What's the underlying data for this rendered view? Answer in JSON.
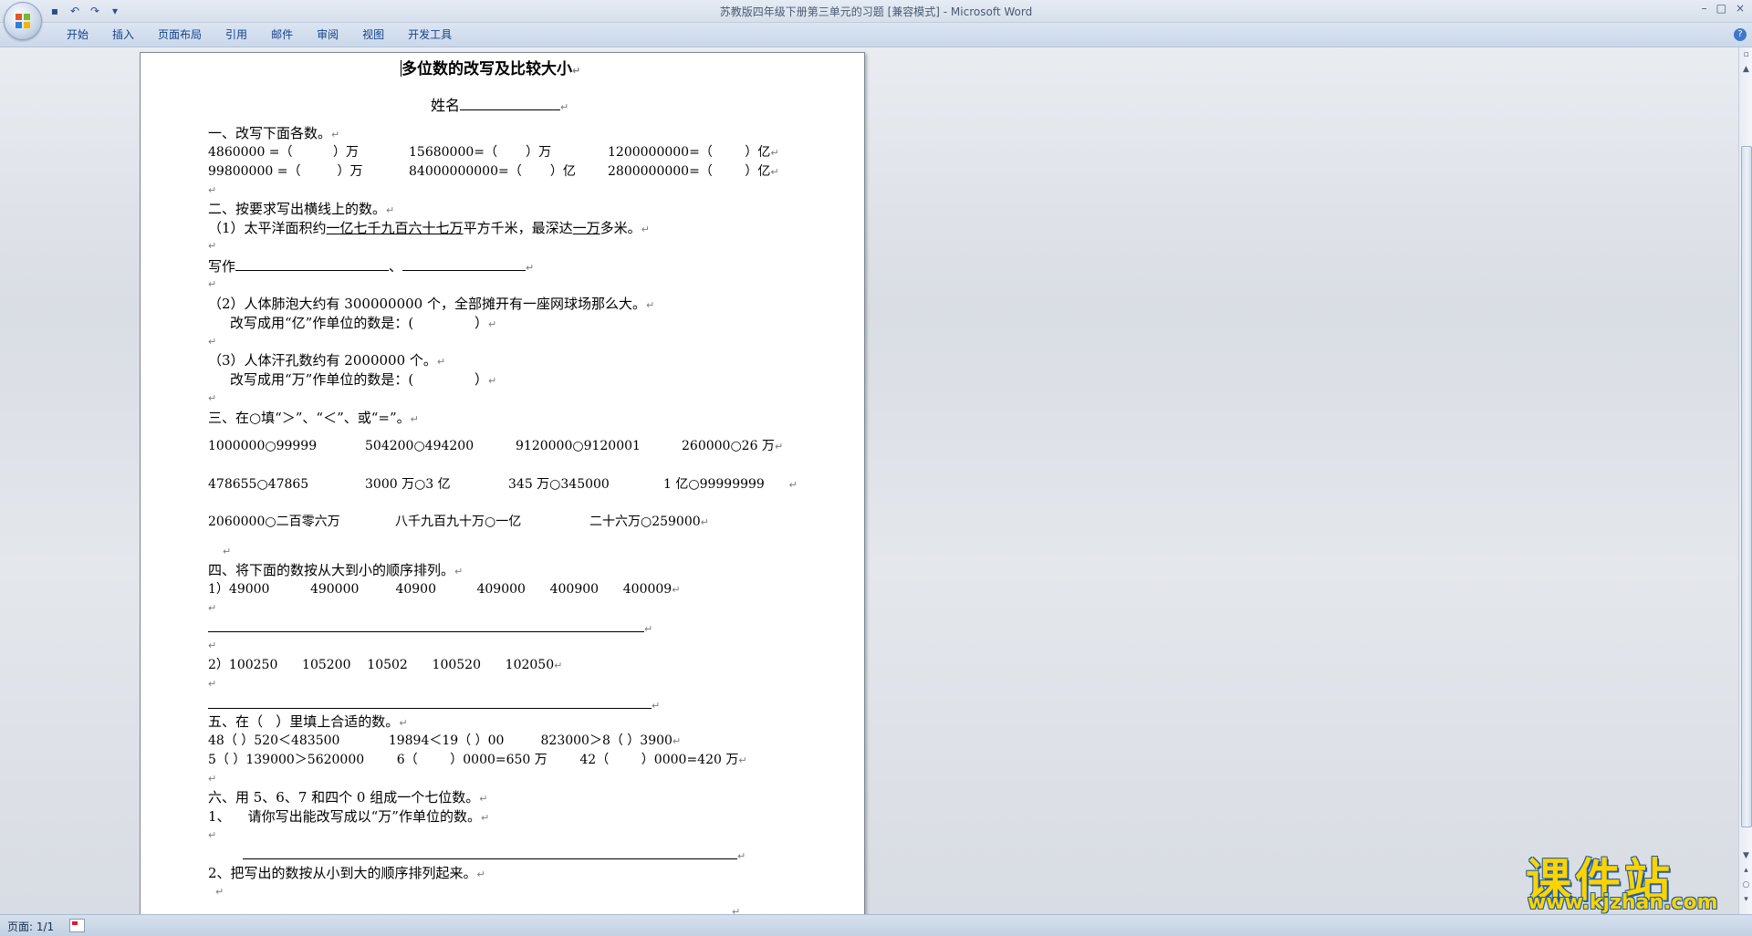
{
  "window": {
    "title": "苏教版四年级下册第三单元的习题 [兼容模式] - Microsoft Word",
    "controls": [
      "–",
      "□",
      "×"
    ]
  },
  "quick_access": {
    "items": [
      {
        "name": "save-icon",
        "glyph": "▪"
      },
      {
        "name": "undo-icon",
        "glyph": "↶"
      },
      {
        "name": "redo-icon",
        "glyph": "↷"
      },
      {
        "name": "customize-icon",
        "glyph": "▾"
      }
    ]
  },
  "ribbon": {
    "tabs": [
      "开始",
      "插入",
      "页面布局",
      "引用",
      "邮件",
      "审阅",
      "视图",
      "开发工具"
    ],
    "help": "?"
  },
  "document": {
    "title": "多位数的改写及比较大小",
    "name_label": "姓名",
    "s1_heading": "一、改写下面各数。",
    "s1_r1": [
      "4860000 =（          ）万",
      "15680000=（       ）万",
      "1200000000=（        ）亿"
    ],
    "s1_r2": [
      "99800000 =（         ）万",
      "84000000000=（       ）亿",
      "2800000000=（        ）亿"
    ],
    "s2_heading": "二、按要求写出横线上的数。",
    "s2_q1_pre": "（1）太平洋面积约",
    "s2_q1_u1": "一亿七千九百六十七万",
    "s2_q1_mid": "平方千米，最深达",
    "s2_q1_u2": "一万",
    "s2_q1_post": "多米。",
    "s2_write": "写作",
    "s2_q2": "（2）人体肺泡大约有 300000000 个，全部摊开有一座网球场那么大。",
    "s2_q2_sub": "改写成用“亿”作单位的数是：(              ）",
    "s2_q3": "（3）人体汗孔数约有 2000000 个。",
    "s2_q3_sub": "改写成用“万”作单位的数是：(              ）",
    "s3_heading": "三、在○填“＞”、“＜”、或“=”。",
    "s3_r1": [
      "1000000○99999",
      "504200○494200",
      "9120000○9120001",
      "260000○26 万"
    ],
    "s3_r2": [
      "478655○47865",
      "3000 万○3 亿",
      "345 万○345000",
      "1 亿○99999999"
    ],
    "s3_r3": [
      "2060000○二百零六万",
      "八千九百九十万○一亿",
      "二十六万○259000"
    ],
    "s4_heading": "四、将下面的数按从大到小的顺序排列。",
    "s4_q1": "1）49000          490000         40900          409000      400900      400009",
    "s4_q2": "2）100250      105200    10502      100520      102050",
    "s5_heading": "五、在（   ）里填上合适的数。",
    "s5_r1": "48（ ）520＜483500            19894＜19（ ）00         823000＞8（ ）3900",
    "s5_r2": "5（ ）139000＞5620000        6（        ）0000=650 万        42（        ）0000=420 万",
    "s6_heading": "六、用 5、6、7 和四个 0 组成一个七位数。",
    "s6_q1": "1、    请你写出能改写成以“万”作单位的数。",
    "s6_q2": "2、把写出的数按从小到大的顺序排列起来。",
    "para_mark": "↵"
  },
  "statusbar": {
    "page": "页面: 1/1"
  },
  "watermark": {
    "cn": "课件站",
    "url": "www.kjzhan.com"
  }
}
